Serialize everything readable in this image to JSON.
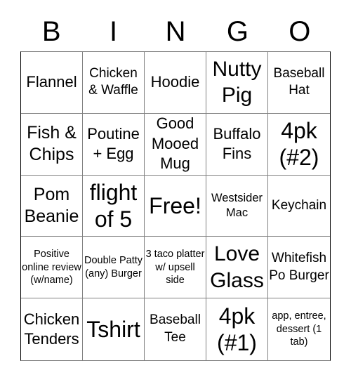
{
  "header": {
    "letters": [
      "B",
      "I",
      "N",
      "G",
      "O"
    ]
  },
  "board": {
    "cells": [
      "Flannel",
      "Chicken & Waffle",
      "Hoodie",
      "Nutty Pig",
      "Baseball Hat",
      "Fish & Chips",
      "Poutine + Egg",
      "Good Mooed Mug",
      "Buffalo Fins",
      "4pk (#2)",
      "Pom Beanie",
      "flight of 5",
      "Free!",
      "Westsider Mac",
      "Keychain",
      "Positive online review (w/name)",
      "Double Patty (any) Burger",
      "3 taco platter w/ upsell side",
      "Love Glass",
      "Whitefish Po Burger",
      "Chicken Tenders",
      "Tshirt",
      "Baseball Tee",
      "4pk (#1)",
      "app, entree, dessert (1 tab)"
    ],
    "free_space_index": 12
  }
}
